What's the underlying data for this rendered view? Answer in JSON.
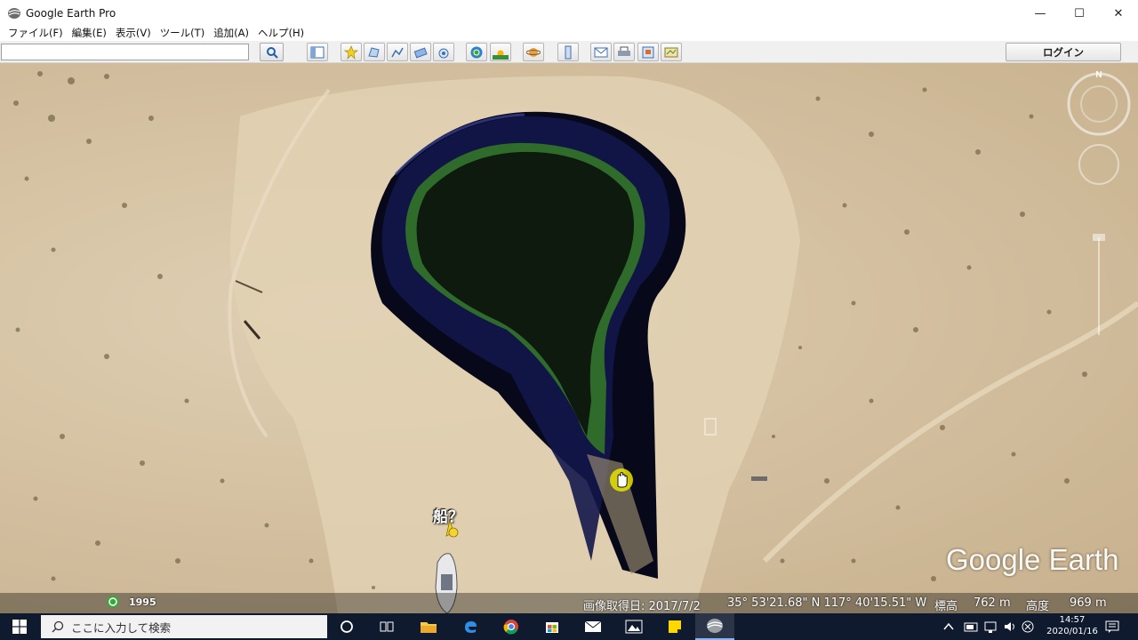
{
  "window": {
    "title": "Google Earth Pro",
    "controls": {
      "minimize": "—",
      "maximize": "☐",
      "close": "✕"
    }
  },
  "menu": [
    "ファイル(F)",
    "編集(E)",
    "表示(V)",
    "ツール(T)",
    "追加(A)",
    "ヘルプ(H)"
  ],
  "toolbar": {
    "search_value": "",
    "login_label": "ログイン",
    "buttons": [
      "search-icon",
      "sidebar-icon",
      "placemark-icon",
      "polygon-icon",
      "path-icon",
      "overlay-icon",
      "tour-icon",
      "historical-imagery-icon",
      "sunlight-icon",
      "planet-icon",
      "ruler-icon",
      "email-icon",
      "print-icon",
      "save-image-icon",
      "view-in-maps-icon"
    ]
  },
  "map": {
    "placemark_label": "船？",
    "historical_year": "1995",
    "logo": "Google Earth",
    "status": {
      "imagery_date": "画像取得日: 2017/7/2",
      "coordinates": "35° 53'21.68\" N  117° 40'15.51\" W",
      "elevation_label": "標高",
      "elevation_value": "762 m",
      "eye_alt_label": "高度",
      "eye_alt_value": "969 m"
    }
  },
  "taskbar": {
    "search_placeholder": "ここに入力して検索",
    "time": "14:57",
    "date": "2020/01/16",
    "apps": [
      "cortana-icon",
      "task-view-icon",
      "file-explorer-icon",
      "edge-icon",
      "chrome-icon",
      "store-icon",
      "mail-icon",
      "photos-icon",
      "sticky-notes-icon",
      "google-earth-icon"
    ]
  }
}
